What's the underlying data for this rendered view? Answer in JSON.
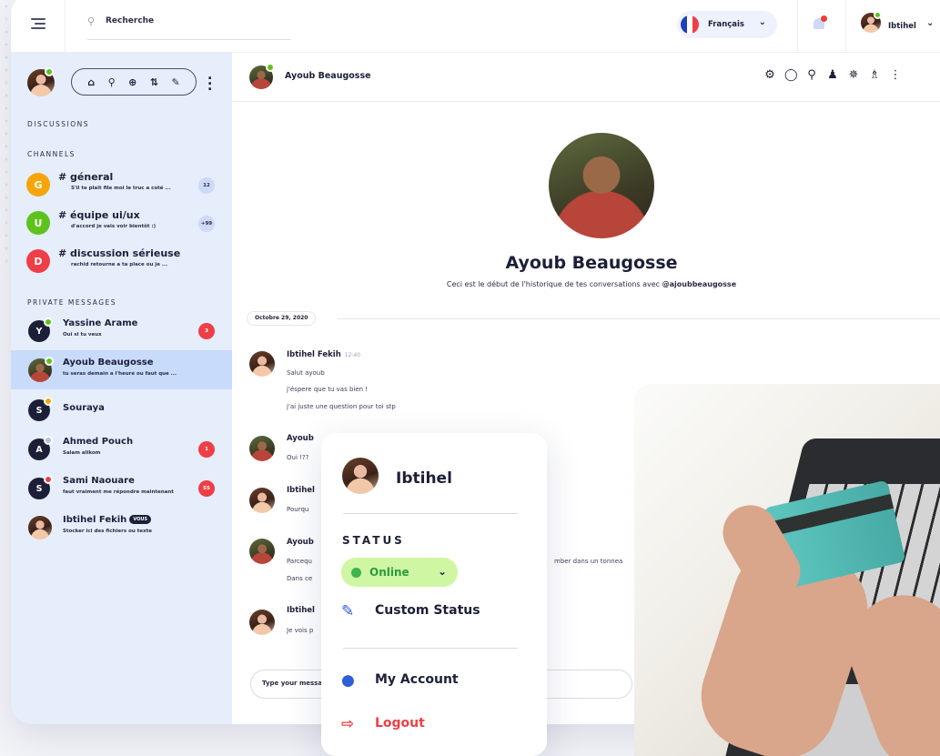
{
  "topbar": {
    "search_placeholder": "Recherche",
    "language": "Français",
    "user": "Ibtihel"
  },
  "sidebar": {
    "discussions_label": "DISCUSSIONS",
    "channels_label": "CHANNELS",
    "private_label": "PRIVATE MESSAGES",
    "channels": [
      {
        "letter": "G",
        "name": "# géneral",
        "preview": "S'il te plait file moi le truc a coté ...",
        "count": "12",
        "color": "#f5a50a"
      },
      {
        "letter": "U",
        "name": "# équipe ui/ux",
        "preview": "d'accord je vais voir bientôt :)",
        "count": "+99",
        "color": "#5ec21c"
      },
      {
        "letter": "D",
        "name": "# discussion sérieuse",
        "preview": "rachid retourne a ta place ou je ...",
        "count": "",
        "color": "#ee3f46"
      }
    ],
    "private_messages": [
      {
        "name": "Yassine Arame",
        "preview": "Oui si tu veux",
        "count": "3",
        "letter": "Y",
        "status": "#5ec21c"
      },
      {
        "name": "Ayoub Beaugosse",
        "preview": "tu seras demain a l'heure ou faut que ...",
        "count": "",
        "status": "#5ec21c"
      },
      {
        "name": "Souraya",
        "preview": "",
        "count": "",
        "letter": "S",
        "status": "#f5a50a"
      },
      {
        "name": "Ahmed Pouch",
        "preview": "Salam alikom",
        "count": "1",
        "letter": "A",
        "status": "#b5bfd6"
      },
      {
        "name": "Sami Naouare",
        "preview": "faut vraiment me répondre maintenant",
        "count": "55",
        "letter": "S",
        "status": "#ee3f46"
      },
      {
        "name": "Ibtihel Fekih",
        "badge": "VOUS",
        "preview": "Stocker ici des fichiers ou texte",
        "count": ""
      }
    ]
  },
  "chat": {
    "title": "Ayoub Beaugosse",
    "profile_name": "Ayoub Beaugosse",
    "intro": "Ceci est le début de l'historique de tes conversations avec",
    "handle": "@ajoubbeaugosse",
    "date": "Octobre 29, 2020",
    "messages": [
      {
        "author": "Ibtihel Fekih",
        "time": "12:40",
        "lines": [
          "Salut ayoub",
          "j'éspere que tu vas bien !",
          "j'ai juste une question pour toi stp"
        ]
      },
      {
        "author": "Ayoub",
        "lines": [
          "Oui !??"
        ]
      },
      {
        "author": "Ibtihel",
        "lines": [
          "Pourqu"
        ]
      },
      {
        "author": "Ayoub",
        "lines": [
          "Parcequ",
          "Dans ce"
        ],
        "tail": "mber dans un tonnea"
      },
      {
        "author": "Ibtihel",
        "lines": [
          "Je vois p"
        ]
      }
    ],
    "composer_placeholder": "Type your messa"
  },
  "dropdown": {
    "name": "Ibtihel",
    "status_label": "STATUS",
    "status_value": "Online",
    "custom_status": "Custom Status",
    "my_account": "My Account",
    "logout": "Logout",
    "colors": {
      "online_bg": "#cff6a3",
      "online_text": "#2b9a3a",
      "logout": "#ee3f46",
      "accent": "#2f5ed6"
    }
  }
}
